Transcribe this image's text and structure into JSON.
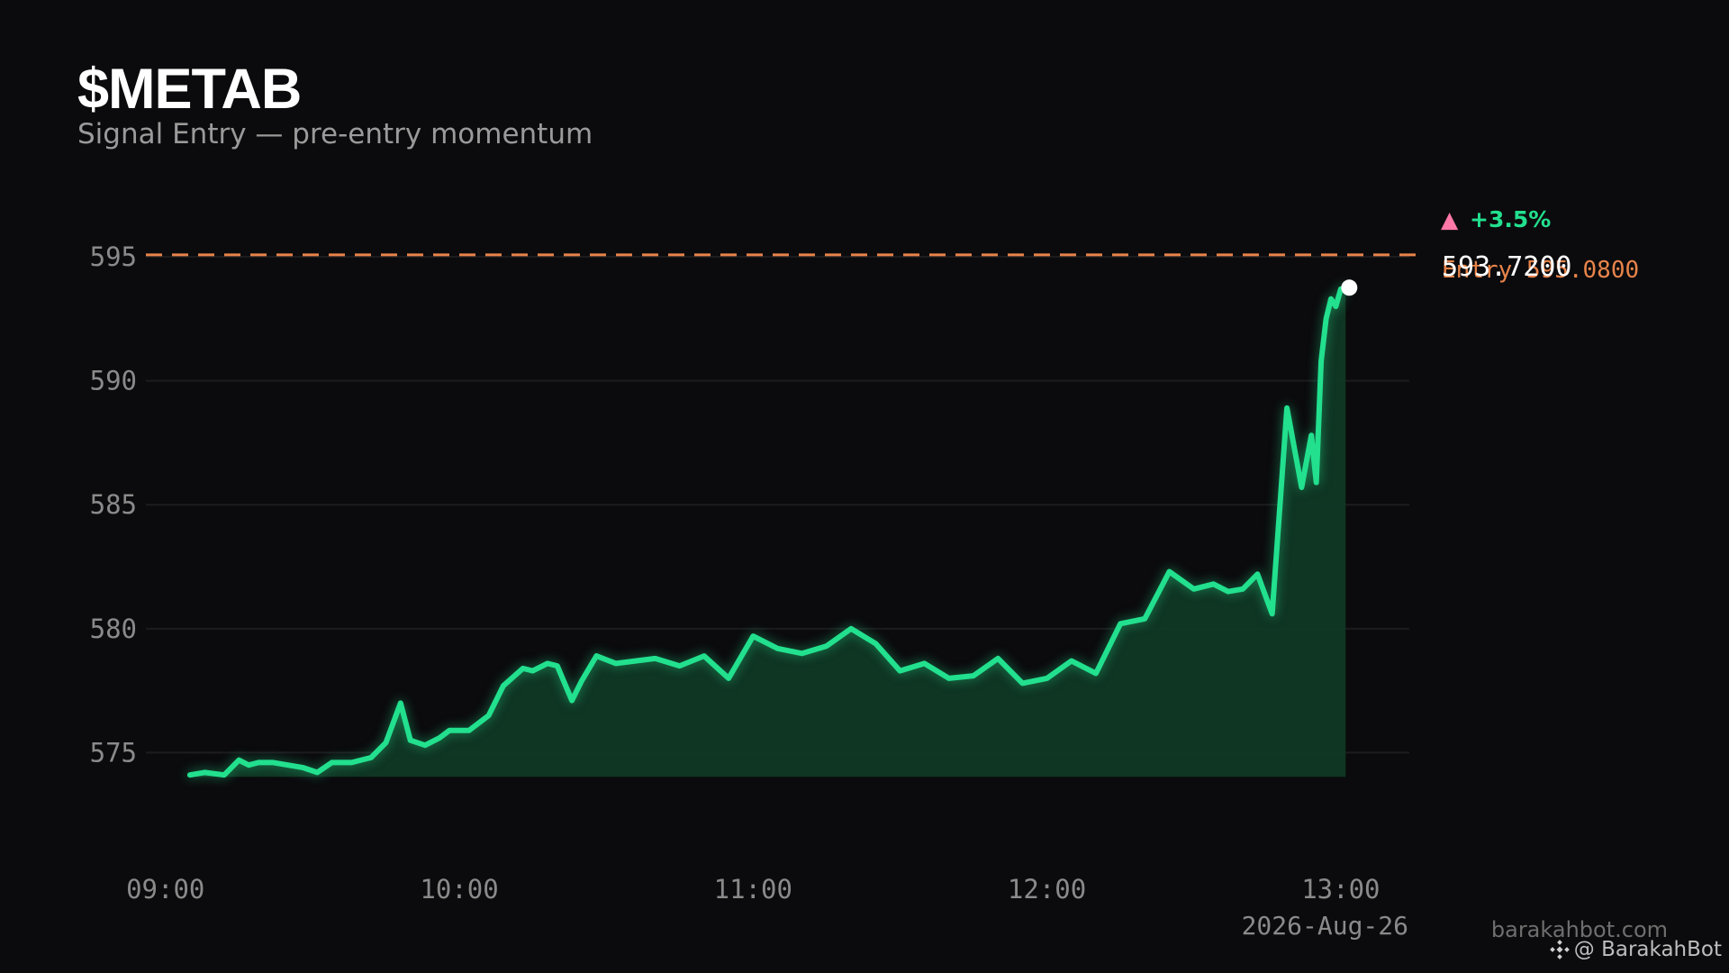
{
  "header": {
    "ticker": "$METAB",
    "subtitle": "Signal Entry — pre-entry momentum"
  },
  "footer": {
    "date": "2026-Aug-26",
    "website": "barakahbot.com",
    "handle": "@ BarakahBot",
    "handle_icon": "binance-logo-icon"
  },
  "colors": {
    "background": "#0b0b0d",
    "line": "#22e08e",
    "fill": "#0f3a26",
    "entry_line": "#e8844a",
    "change_arrow": "#ff79a8",
    "grid": "#1c1c1f"
  },
  "chart_data": {
    "type": "line",
    "title": "$METAB",
    "subtitle": "Signal Entry — pre-entry momentum",
    "x_ticks": [
      "09:00",
      "10:00",
      "11:00",
      "12:00",
      "13:00"
    ],
    "y_ticks": [
      575,
      580,
      585,
      590,
      595
    ],
    "xlim": [
      "08:56",
      "13:14"
    ],
    "ylim": [
      571.2,
      597.0
    ],
    "grid": "horizontal",
    "entry": {
      "label": "Entry",
      "value": 595.08,
      "text": "Entry 595.0800"
    },
    "last": {
      "value": 593.72,
      "text": "593.7200"
    },
    "change": {
      "arrow": "▲",
      "text": "+3.5%"
    },
    "series": [
      {
        "x": [
          "09:05",
          "09:08",
          "09:12",
          "09:15",
          "09:17",
          "09:19",
          "09:22",
          "09:25",
          "09:28",
          "09:31",
          "09:34",
          "09:38",
          "09:42",
          "09:45",
          "09:48",
          "09:50",
          "09:53",
          "09:56",
          "09:58",
          "10:02",
          "10:06",
          "10:09",
          "10:13",
          "10:15",
          "10:18",
          "10:20",
          "10:23",
          "10:25",
          "10:28",
          "10:32",
          "10:36",
          "10:40",
          "10:45",
          "10:50",
          "10:55",
          "11:00",
          "11:05",
          "11:10",
          "11:15",
          "11:20",
          "11:25",
          "11:30",
          "11:35",
          "11:40",
          "11:45",
          "11:50",
          "11:55",
          "12:00",
          "12:05",
          "12:10",
          "12:15",
          "12:20",
          "12:25",
          "12:30",
          "12:34",
          "12:37",
          "12:40",
          "12:43",
          "12:46",
          "12:49",
          "12:52",
          "12:54",
          "12:55",
          "12:56",
          "12:57",
          "12:58",
          "12:59",
          "13:00",
          "13:01"
        ],
        "y": [
          574.1,
          574.2,
          574.1,
          574.7,
          574.5,
          574.6,
          574.6,
          574.5,
          574.4,
          574.2,
          574.6,
          574.6,
          574.8,
          575.4,
          577.0,
          575.5,
          575.3,
          575.6,
          575.9,
          575.9,
          576.5,
          577.7,
          578.4,
          578.3,
          578.6,
          578.5,
          577.1,
          577.9,
          578.9,
          578.6,
          578.7,
          578.8,
          578.5,
          578.9,
          578.0,
          579.7,
          579.2,
          579.0,
          579.3,
          580.0,
          579.4,
          578.3,
          578.6,
          578.0,
          578.1,
          578.8,
          577.8,
          578.0,
          578.7,
          578.2,
          580.2,
          580.4,
          582.3,
          581.6,
          581.8,
          581.5,
          581.6,
          582.2,
          580.6,
          588.9,
          585.7,
          587.8,
          585.9,
          590.8,
          592.5,
          593.3,
          593.0,
          593.7,
          593.72
        ]
      }
    ]
  }
}
